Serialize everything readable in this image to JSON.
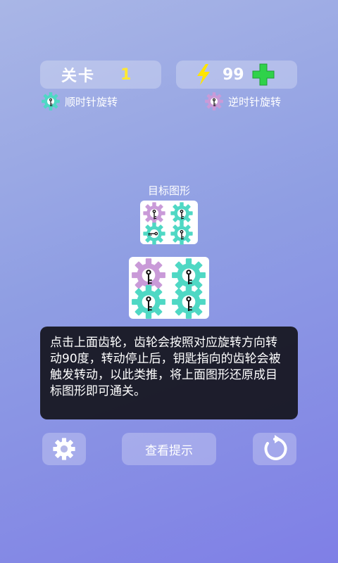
{
  "header": {
    "level_label": "关卡",
    "level_value": "1",
    "energy_value": "99"
  },
  "legend": {
    "clockwise_label": "顺时针旋转",
    "counterclockwise_label": "逆时针旋转"
  },
  "target_label": "目标图形",
  "help_text": "点击上面齿轮，齿轮会按照对应旋转方向转动90度，转动停止后，钥匙指向的齿轮会被触发转动，以此类推，将上面图形还原成目标图形即可通关。",
  "buttons": {
    "hint_label": "查看提示"
  },
  "colors": {
    "clockwise_gear": "#4fd8c4",
    "counterclockwise_gear": "#c99ad8",
    "level_value": "#ffe833",
    "lightning": "#ffe500",
    "plus": "#2fd24a"
  },
  "icons": {
    "energy": "lightning-icon",
    "add": "plus-icon",
    "settings": "gear-icon",
    "restart": "restart-icon"
  }
}
